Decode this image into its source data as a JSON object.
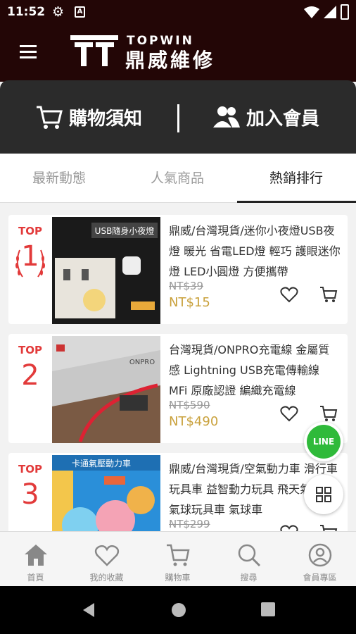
{
  "status_bar": {
    "time": "11:52",
    "a_label": "A"
  },
  "header": {
    "logo_en": "TOPWIN",
    "logo_zh": "鼎威維修"
  },
  "actions": {
    "guide": "購物須知",
    "join": "加入會員"
  },
  "tabs": [
    {
      "label": "最新動態"
    },
    {
      "label": "人氣商品"
    },
    {
      "label": "熱銷排行"
    }
  ],
  "products": [
    {
      "rank_label": "TOP",
      "rank": "1",
      "title": "鼎威/台灣現貨/迷你小夜燈USB夜燈 暖光 省電LED燈 輕巧 護眼迷你燈 LED小圓燈 方便攜帶",
      "old_price": "NT$39",
      "price": "NT$15",
      "thumb_text": "USB隨身小夜燈"
    },
    {
      "rank_label": "TOP",
      "rank": "2",
      "title": "台灣現貨/ONPRO充電線 金屬質感 Lightning USB充電傳輸線 MFi 原廠認證 編織充電線",
      "old_price": "NT$590",
      "price": "NT$490",
      "thumb_text": "ONPRO"
    },
    {
      "rank_label": "TOP",
      "rank": "3",
      "title": "鼎威/台灣現貨/空氣動力車 滑行車 玩具車 益智動力玩具 飛天氣球車 氣球玩具車 氣球車",
      "old_price": "NT$299",
      "price": "",
      "thumb_text": "卡通氣壓動力車"
    }
  ],
  "line_button": "LINE",
  "bottom_nav": [
    {
      "label": "首頁",
      "icon": "home-icon"
    },
    {
      "label": "我的收藏",
      "icon": "heart-icon"
    },
    {
      "label": "購物車",
      "icon": "cart-icon"
    },
    {
      "label": "搜尋",
      "icon": "search-icon"
    },
    {
      "label": "會員專區",
      "icon": "user-icon"
    }
  ],
  "colors": {
    "header_bg": "#230606",
    "accent_red": "#e23a3a",
    "price_gold": "#c9a13c",
    "line_green": "#2fba3a"
  }
}
